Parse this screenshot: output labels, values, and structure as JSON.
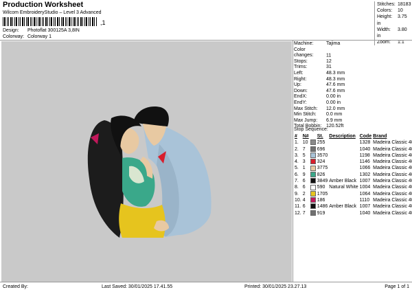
{
  "header": {
    "title": "Production Worksheet",
    "subtitle": "Wilcom EmbroideryStudio – Level 3 Advanced",
    "barcode_suffix": ",1",
    "design_label": "Design:",
    "design_value": "Photoflat 300125A 3,8IN",
    "colorway_label": "Colorway:",
    "colorway_value": "Colorway 1"
  },
  "stats": [
    {
      "label": "Stitches:",
      "value": "18183"
    },
    {
      "label": "Colors:",
      "value": "10"
    },
    {
      "label": "Height:",
      "value": "3.75 in"
    },
    {
      "label": "Width:",
      "value": "3.80 in"
    },
    {
      "label": "Zoom:",
      "value": "1:1"
    }
  ],
  "machine_info": [
    {
      "label": "Machine:",
      "value": "Tajima"
    },
    {
      "label": "Color changes:",
      "value": "11"
    },
    {
      "label": "Stops:",
      "value": "12"
    },
    {
      "label": "Trims:",
      "value": "31"
    },
    {
      "label": "Left:",
      "value": "48.3 mm"
    },
    {
      "label": "Right:",
      "value": "48.3 mm"
    },
    {
      "label": "Up:",
      "value": "47.6 mm"
    },
    {
      "label": "Down:",
      "value": "47.6 mm"
    },
    {
      "label": "EndX:",
      "value": "0.00 in"
    },
    {
      "label": "EndY:",
      "value": "0.00 in"
    },
    {
      "label": "Max Stitch:",
      "value": "12.0 mm"
    },
    {
      "label": "Min Stitch:",
      "value": "0.0 mm"
    },
    {
      "label": "Max Jump:",
      "value": "6.9 mm"
    },
    {
      "label": "Total Bobbin:",
      "value": "120.52ft"
    }
  ],
  "sequence": {
    "title": "Stop Sequence:",
    "columns": [
      "#",
      "N#",
      "St.",
      "Description",
      "Code",
      "Brand"
    ],
    "rows": [
      {
        "idx": "1.",
        "needle": "10",
        "color": "#8a8a8a",
        "stitches": "255",
        "desc": "",
        "code": "1328",
        "brand": "Madeira Classic 40"
      },
      {
        "idx": "2.",
        "needle": "7",
        "color": "#707070",
        "stitches": "696",
        "desc": "",
        "code": "1040",
        "brand": "Madeira Classic 40"
      },
      {
        "idx": "3.",
        "needle": "5",
        "color": "#a9c3d8",
        "stitches": "3570",
        "desc": "",
        "code": "1198",
        "brand": "Madeira Classic 40"
      },
      {
        "idx": "4.",
        "needle": "3",
        "color": "#d81e2c",
        "stitches": "324",
        "desc": "",
        "code": "1146",
        "brand": "Madeira Classic 40"
      },
      {
        "idx": "5.",
        "needle": "1",
        "color": "#e8c9a2",
        "stitches": "3775",
        "desc": "",
        "code": "1066",
        "brand": "Madeira Classic 40"
      },
      {
        "idx": "6.",
        "needle": "9",
        "color": "#3aa88a",
        "stitches": "826",
        "desc": "",
        "code": "1302",
        "brand": "Madeira Classic 40"
      },
      {
        "idx": "7.",
        "needle": "6",
        "color": "#111111",
        "stitches": "3849",
        "desc": "Amber Black",
        "code": "1007",
        "brand": "Madeira Classic 40"
      },
      {
        "idx": "8.",
        "needle": "6",
        "color": "#ffffff",
        "stitches": "590",
        "desc": "Natural White",
        "code": "1004",
        "brand": "Madeira Classic 40"
      },
      {
        "idx": "9.",
        "needle": "2",
        "color": "#e6c41e",
        "stitches": "1705",
        "desc": "",
        "code": "1064",
        "brand": "Madeira Classic 40"
      },
      {
        "idx": "10.",
        "needle": "4",
        "color": "#c2185b",
        "stitches": "186",
        "desc": "",
        "code": "1110",
        "brand": "Madeira Classic 40"
      },
      {
        "idx": "11.",
        "needle": "6",
        "color": "#111111",
        "stitches": "1486",
        "desc": "Amber Black",
        "code": "1007",
        "brand": "Madeira Classic 40"
      },
      {
        "idx": "12.",
        "needle": "7",
        "color": "#707070",
        "stitches": "919",
        "desc": "",
        "code": "1040",
        "brand": "Madeira Classic 40"
      }
    ]
  },
  "footer": {
    "created_by": "Created By:",
    "last_saved": "Last Saved: 30/01/2025 17.41.55",
    "printed": "Printed: 30/01/2025 23.27.13",
    "page": "Page 1 of 1"
  }
}
